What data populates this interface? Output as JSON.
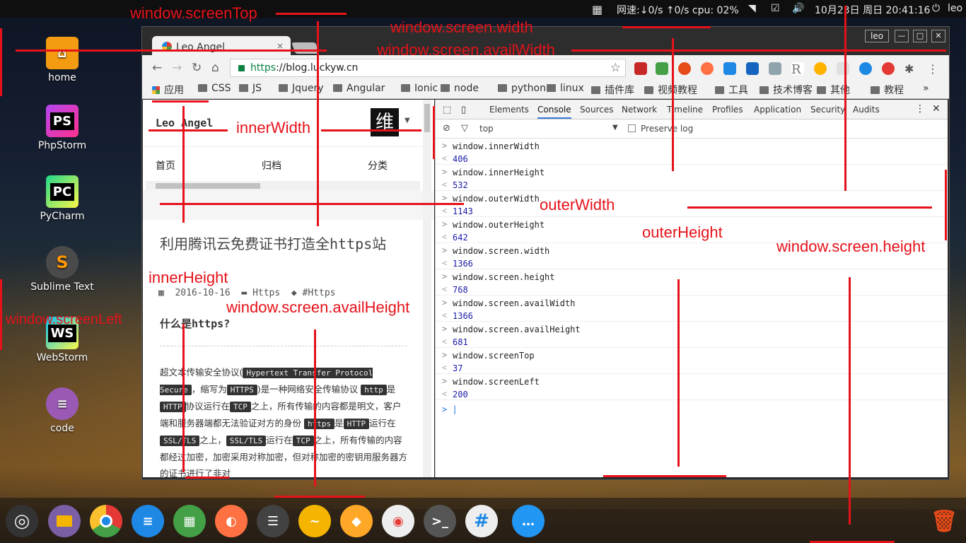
{
  "topbar": {
    "net": "网速:↓0/s ↑0/s cpu: 02%",
    "datetime": "10月23日 周日 20:41:16",
    "user": "leo"
  },
  "desktop": [
    {
      "label": "home"
    },
    {
      "label": "PhpStorm",
      "abbr": "PS"
    },
    {
      "label": "PyCharm",
      "abbr": "PC"
    },
    {
      "label": "Sublime Text",
      "abbr": "S"
    },
    {
      "label": "WebStorm",
      "abbr": "WS"
    },
    {
      "label": "code"
    }
  ],
  "browser": {
    "tab_title": "Leo Angel",
    "tab_close": "×",
    "user_badge": "leo",
    "url_scheme": "https",
    "url_rest": "://blog.luckyw.cn",
    "bookmarks": [
      "应用",
      "CSS",
      "JS",
      "Jquery",
      "Angular",
      "Ionic",
      "node",
      "python",
      "linux",
      "插件库",
      "视频教程",
      "工具",
      "技术博客",
      "其他",
      "教程"
    ],
    "bookmarks_more": "»"
  },
  "page": {
    "site_name": "Leo Angel",
    "logo_char": "维",
    "nav": [
      "首页",
      "归档",
      "分类"
    ],
    "post_title": "利用腾讯云免费证书打造全https站",
    "date": "2016-10-16",
    "category": "Https",
    "tag": "#Https",
    "heading": "什么是https?",
    "p1": "超文本传输安全协议(",
    "code1": "Hypertext Transfer Protocol Secure",
    "p2": "，缩写为",
    "code2": "HTTPS",
    "p3": ")是一种网络安全传输协议",
    "code3": "http",
    "p4": "是",
    "code4": "HTTP",
    "p5": "协议运行在",
    "code5": "TCP",
    "p6": "之上，所有传输的内容都是明文，客户端和服务器端都无法验证对方的身份",
    "code6": "https",
    "p7": "是",
    "code7": "HTTP",
    "p8": "运行在",
    "code8": "SSL/TLS",
    "p9": "之上，",
    "code9": "SSL/TLS",
    "p10": "运行在",
    "code10": "TCP",
    "p11": "之上，所有传输的内容都经过加密，加密采用对称加密，但对称加密的密钥用服务器方的证书进行了非对"
  },
  "devtools": {
    "tabs": [
      "Elements",
      "Console",
      "Sources",
      "Network",
      "Timeline",
      "Profiles",
      "Application",
      "Security",
      "Audits"
    ],
    "active_tab": "Console",
    "context": "top",
    "preserve_log": "Preserve log",
    "rows": [
      {
        "cmd": "window.innerWidth",
        "res": "406"
      },
      {
        "cmd": "window.innerHeight",
        "res": "532"
      },
      {
        "cmd": "window.outerWidth",
        "res": "1143"
      },
      {
        "cmd": "window.outerHeight",
        "res": "642"
      },
      {
        "cmd": "window.screen.width",
        "res": "1366"
      },
      {
        "cmd": "window.screen.height",
        "res": "768"
      },
      {
        "cmd": "window.screen.availWidth",
        "res": "1366"
      },
      {
        "cmd": "window.screen.availHeight",
        "res": "681"
      },
      {
        "cmd": "window.screenTop",
        "res": "37"
      },
      {
        "cmd": "window.screenLeft",
        "res": "200"
      }
    ]
  },
  "annotations": {
    "screenTop": "window.screenTop",
    "screen_width": "window.screen.width",
    "availWidth": "window.screen.availWidth",
    "innerWidth": "innerWidth",
    "outerWidth": "outerWidth",
    "outerHeight": "outerHeight",
    "screen_height": "window.screen.height",
    "innerHeight": "innerHeight",
    "availHeight": "window.screen.availHeight",
    "screenLeft": "window.screenLeft"
  },
  "colors": {
    "annotation": "#e5121a",
    "https_green": "#0b8043",
    "console_value": "#1a1aa6"
  }
}
